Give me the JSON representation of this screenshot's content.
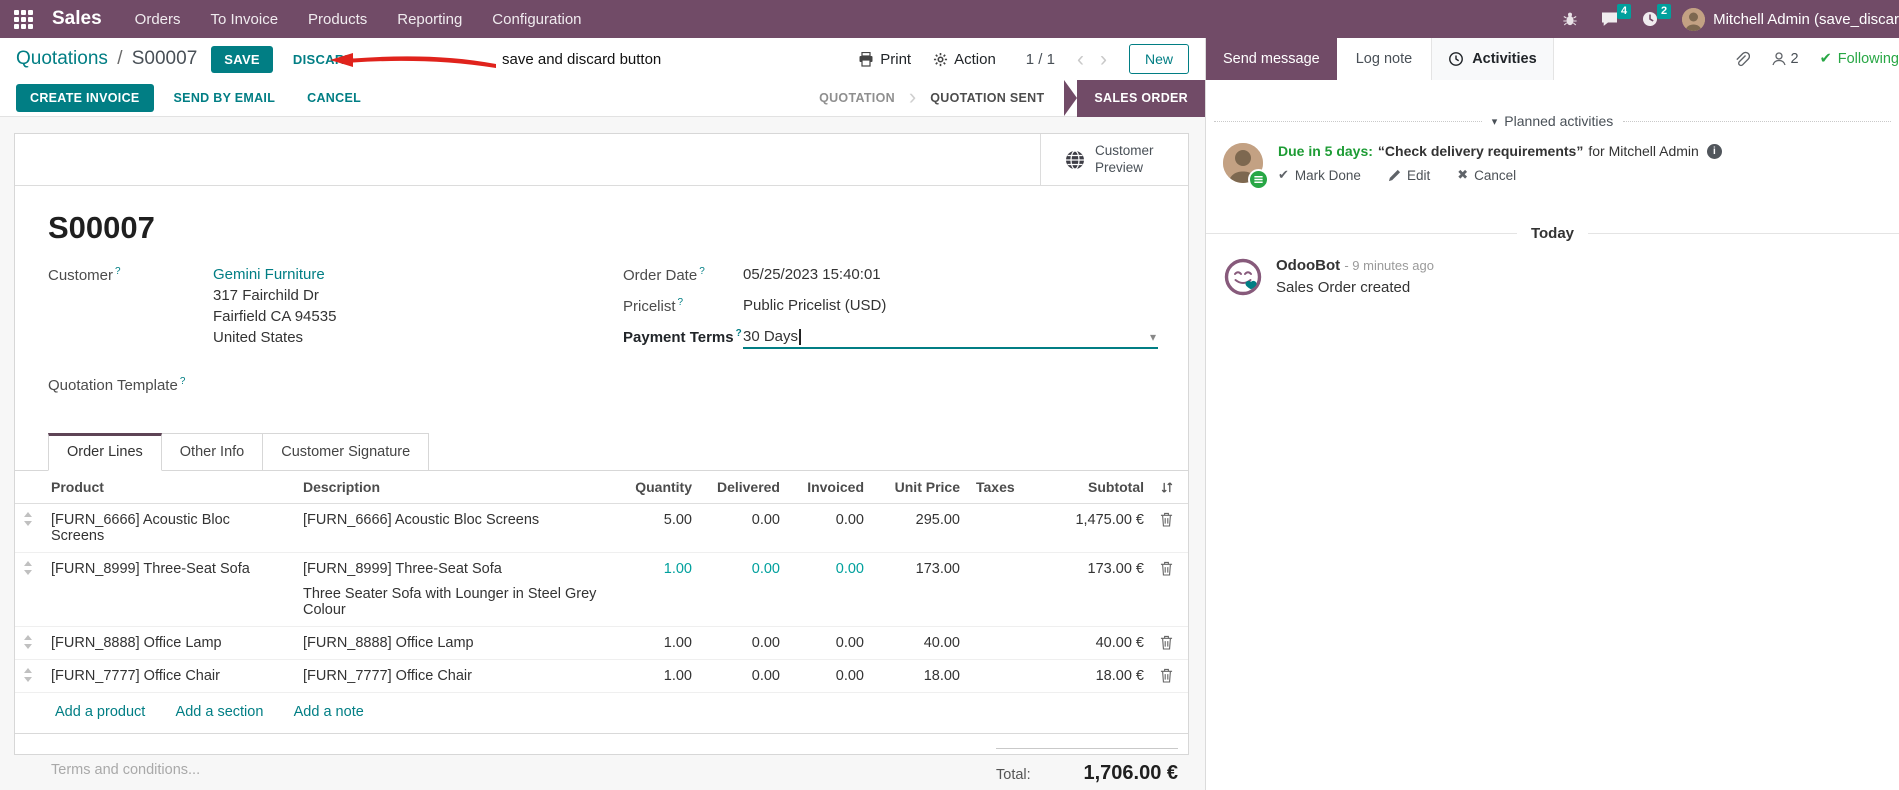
{
  "icons": {
    "stage_sep": "›",
    "chevron_prev": "‹",
    "chevron_next": "›",
    "caret_down": "▾",
    "check": "✔",
    "cross": "✖",
    "info_glyph": "i",
    "planned_caret": "▾"
  },
  "navbar": {
    "app_name": "Sales",
    "menus": [
      "Orders",
      "To Invoice",
      "Products",
      "Reporting",
      "Configuration"
    ],
    "message_badge": "4",
    "activity_badge": "2",
    "user_name": "Mitchell Admin (save_discar",
    "colors": {
      "bg": "#714B67",
      "badge": "#00A09D"
    }
  },
  "control_panel": {
    "breadcrumb_parent": "Quotations",
    "breadcrumb_sep": "/",
    "breadcrumb_current": "S00007",
    "save_label": "SAVE",
    "discard_label": "DISCARD",
    "annotation": "save and discard button",
    "print_label": "Print",
    "action_label": "Action",
    "pager": "1 / 1",
    "new_label": "New"
  },
  "statusbar": {
    "create_invoice": "CREATE INVOICE",
    "send_by_email": "SEND BY EMAIL",
    "cancel": "CANCEL",
    "stages": [
      "QUOTATION",
      "QUOTATION SENT",
      "SALES ORDER"
    ],
    "active_stage": "SALES ORDER",
    "active_color": "#714B67"
  },
  "form": {
    "preview_button": "Customer Preview",
    "title": "S00007",
    "help_marker": "?",
    "fields": {
      "customer_label": "Customer",
      "customer_name": "Gemini Furniture",
      "address": [
        "317 Fairchild Dr",
        "Fairfield CA 94535",
        "United States"
      ],
      "quotation_template_label": "Quotation Template",
      "order_date_label": "Order Date",
      "order_date_value": "05/25/2023 15:40:01",
      "pricelist_label": "Pricelist",
      "pricelist_value": "Public Pricelist (USD)",
      "payment_terms_label": "Payment Terms",
      "payment_terms_value": "30 Days"
    },
    "tabs": [
      "Order Lines",
      "Other Info",
      "Customer Signature"
    ],
    "table": {
      "columns": [
        "Product",
        "Description",
        "Quantity",
        "Delivered",
        "Invoiced",
        "Unit Price",
        "Taxes",
        "Subtotal"
      ],
      "rows": [
        {
          "product": "[FURN_6666] Acoustic Bloc Screens",
          "desc": "[FURN_6666] Acoustic Bloc Screens",
          "desc2": "",
          "qty": "5.00",
          "delivered": "0.00",
          "invoiced": "0.00",
          "unit_price": "295.00",
          "taxes": "",
          "subtotal": "1,475.00 €",
          "modified": false
        },
        {
          "product": "[FURN_8999] Three-Seat Sofa",
          "desc": "[FURN_8999] Three-Seat Sofa",
          "desc2": "Three Seater Sofa with Lounger in Steel Grey Colour",
          "qty": "1.00",
          "delivered": "0.00",
          "invoiced": "0.00",
          "unit_price": "173.00",
          "taxes": "",
          "subtotal": "173.00 €",
          "modified": true
        },
        {
          "product": "[FURN_8888] Office Lamp",
          "desc": "[FURN_8888] Office Lamp",
          "desc2": "",
          "qty": "1.00",
          "delivered": "0.00",
          "invoiced": "0.00",
          "unit_price": "40.00",
          "taxes": "",
          "subtotal": "40.00 €",
          "modified": false
        },
        {
          "product": "[FURN_7777] Office Chair",
          "desc": "[FURN_7777] Office Chair",
          "desc2": "",
          "qty": "1.00",
          "delivered": "0.00",
          "invoiced": "0.00",
          "unit_price": "18.00",
          "taxes": "",
          "subtotal": "18.00 €",
          "modified": false
        }
      ],
      "links": [
        "Add a product",
        "Add a section",
        "Add a note"
      ]
    },
    "terms_placeholder": "Terms and conditions...",
    "total_label": "Total:",
    "total_value": "1,706.00 €"
  },
  "chatter": {
    "send_message": "Send message",
    "log_note": "Log note",
    "activities_label": "Activities",
    "follower_count": "2",
    "following_label": "Following",
    "planned_header": "Planned activities",
    "activity": {
      "due": "Due in 5 days:",
      "summary": "“Check delivery requirements”",
      "assignee": "for Mitchell Admin",
      "actions": [
        "Mark Done",
        "Edit",
        "Cancel"
      ]
    },
    "today_label": "Today",
    "message": {
      "author": "OdooBot",
      "time": "- 9 minutes ago",
      "body": "Sales Order created"
    }
  }
}
